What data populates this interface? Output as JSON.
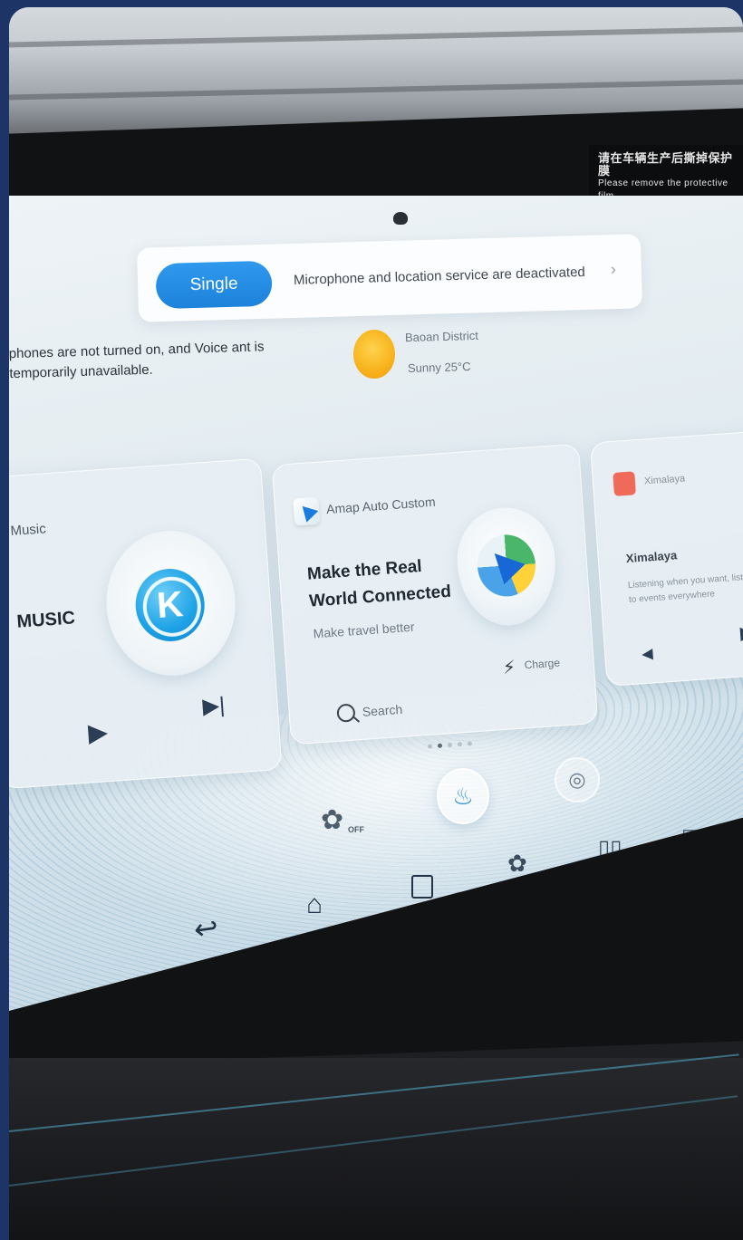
{
  "header": {
    "mode_button": "Single",
    "status_message": "Microphone and location service are deactivated",
    "chevron": "›"
  },
  "voice_notice": "phones are not turned on, and Voice ant is temporarily unavailable.",
  "weather": {
    "location": "Baoan District",
    "condition": "Sunny 25°C",
    "icon": "sun-icon"
  },
  "cards": {
    "music": {
      "app_label": "Music",
      "title": "MUSIC",
      "logo_letter": "K",
      "play_icon": "▶",
      "next_icon": "▶|"
    },
    "amap": {
      "app_name": "Amap Auto Custom",
      "headline": "Make the Real World Connected",
      "subtitle": "Make travel better",
      "search_label": "Search",
      "charge_label": "Charge",
      "charge_icon": "⚡"
    },
    "ximalaya": {
      "app_name": "Ximalaya",
      "title": "Ximalaya",
      "description": "Listening when you want, listen to events everywhere",
      "prev_icon": "◀",
      "play_icon": "▶"
    }
  },
  "pager": {
    "total": 5,
    "active": 1
  },
  "dock": {
    "fan_icon": "✿",
    "fan_state": "OFF",
    "seat_icon": "♨",
    "wheel_icon": "◎",
    "back_icon": "↩",
    "home_icon": "⌂",
    "rear_fan_icon": "✿",
    "split_icon": "▯▯",
    "rear_icon": "▭"
  },
  "sticker": {
    "line1": "请在车辆生产后撕掉保护膜",
    "line2": "Please remove the protective film"
  }
}
